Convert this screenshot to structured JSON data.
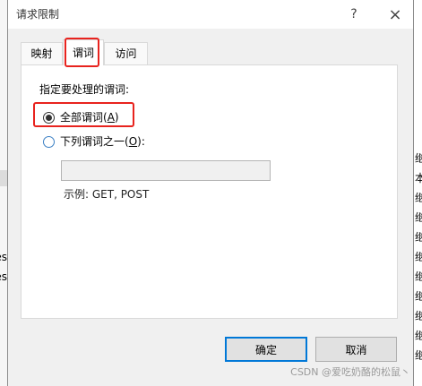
{
  "window": {
    "title": "请求限制",
    "help_icon": "?",
    "close_icon": "×"
  },
  "tabs": [
    {
      "label": "映射",
      "selected": false
    },
    {
      "label": "谓词",
      "selected": true
    },
    {
      "label": "访问",
      "selected": false
    }
  ],
  "verbs_page": {
    "heading": "指定要处理的谓词:",
    "options": [
      {
        "label_before_key": "全部谓词(",
        "access_key": "A",
        "label_after_key": ")",
        "checked": true
      },
      {
        "label_before_key": "下列谓词之一(",
        "access_key": "O",
        "label_after_key": "):",
        "checked": false
      }
    ],
    "verb_list": {
      "value": "",
      "enabled": false
    },
    "example": "示例: GET, POST"
  },
  "buttons": {
    "ok_label": "确定",
    "cancel_label": "取消"
  },
  "colors": {
    "annotation_box": "#e8231e",
    "default_button_border": "#0078d7"
  },
  "icons": {
    "help": "help-icon",
    "close": "close-icon"
  },
  "watermark": "CSDN @爱吃奶酪的松鼠丶",
  "background_window": {
    "left_column_fragments": [
      "es",
      "es"
    ],
    "right_column_entries": [
      "继承",
      "本地",
      "继承",
      "继承",
      "继承",
      "继承",
      "继承",
      "继承",
      "继承",
      "继承",
      "继承"
    ]
  }
}
